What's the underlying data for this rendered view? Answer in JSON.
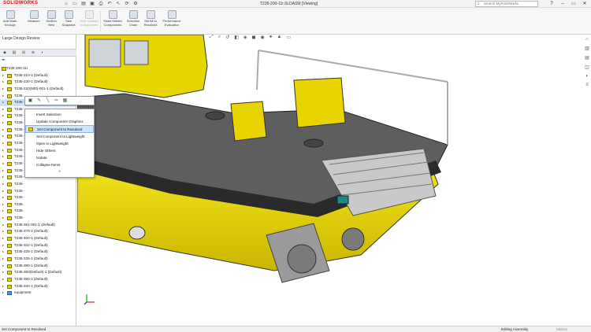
{
  "app": {
    "brand": "SOLIDWORKS",
    "doc_title": "T235-200-11r.SLDASM [Viewing]",
    "search_placeholder": "Search MySolidWorks"
  },
  "ribbon": [
    {
      "label": "Add Walk-through",
      "enabled": true
    },
    {
      "label": "Measure",
      "enabled": true
    },
    {
      "label": "Section View",
      "enabled": true
    },
    {
      "label": "Take Snapshot",
      "enabled": true
    },
    {
      "label": "Hide Isolated Components",
      "enabled": false
    },
    {
      "label": "Show Hidden Components",
      "enabled": true
    },
    {
      "label": "Selection Chain",
      "enabled": true
    },
    {
      "label": "Set All to Resolved",
      "enabled": true
    },
    {
      "label": "Performance Evaluation",
      "enabled": true
    }
  ],
  "panel": {
    "title": "Large Design Review"
  },
  "tree": [
    {
      "label": "T235-200-11r",
      "root": true
    },
    {
      "label": "T235-210-1 (Default)"
    },
    {
      "label": "T235-220-1 (Default)"
    },
    {
      "label": "T235-220(500)-001-1 (Default)"
    },
    {
      "label": "T235-"
    },
    {
      "label": "T235-",
      "selected": true
    },
    {
      "label": "T235-"
    },
    {
      "label": "T235-"
    },
    {
      "label": "T235-"
    },
    {
      "label": "T235-"
    },
    {
      "label": "T235-"
    },
    {
      "label": "T235-"
    },
    {
      "label": "T235-"
    },
    {
      "label": "T235-"
    },
    {
      "label": "T235-"
    },
    {
      "label": "T235-"
    },
    {
      "label": "T235-"
    },
    {
      "label": "T235-"
    },
    {
      "label": "T235-"
    },
    {
      "label": "T235-"
    },
    {
      "label": "T235-"
    },
    {
      "label": "T235-"
    },
    {
      "label": "T235-"
    },
    {
      "label": "T235-361-001-1 (Default)"
    },
    {
      "label": "T235-370-1 (Default)"
    },
    {
      "label": "T235-400-1 (Default)"
    },
    {
      "label": "T235-322-1 (Default)"
    },
    {
      "label": "T235-325-1 (Default)"
    },
    {
      "label": "T235-335-1 (Default)"
    },
    {
      "label": "T235-390-1 (Default)"
    },
    {
      "label": "T235-350(Default)-1 (Default)"
    },
    {
      "label": "T235-350-1 (Default)"
    },
    {
      "label": "T235-340-1 (Default)"
    },
    {
      "label": "equipment",
      "folder": true
    }
  ],
  "context_menu": [
    {
      "label": "Invert Selection"
    },
    {
      "label": "Update Component Graphics"
    },
    {
      "label": "Set Component to Resolved",
      "highlighted": true
    },
    {
      "label": "Set Component to Lightweight"
    },
    {
      "label": "Open in Lightweight"
    },
    {
      "label": "Hide Others"
    },
    {
      "label": "Isolate"
    },
    {
      "label": "Collapse Items"
    }
  ],
  "context_more": "»",
  "status": {
    "left": "Set Component to Resolved",
    "mode": "Editing Assembly",
    "units": "MMGS"
  },
  "colors": {
    "boat_yellow": "#E8D400",
    "deck_gray": "#5E5E5E",
    "selection_blue": "#CFE3FB",
    "brand_red": "#D11111"
  }
}
